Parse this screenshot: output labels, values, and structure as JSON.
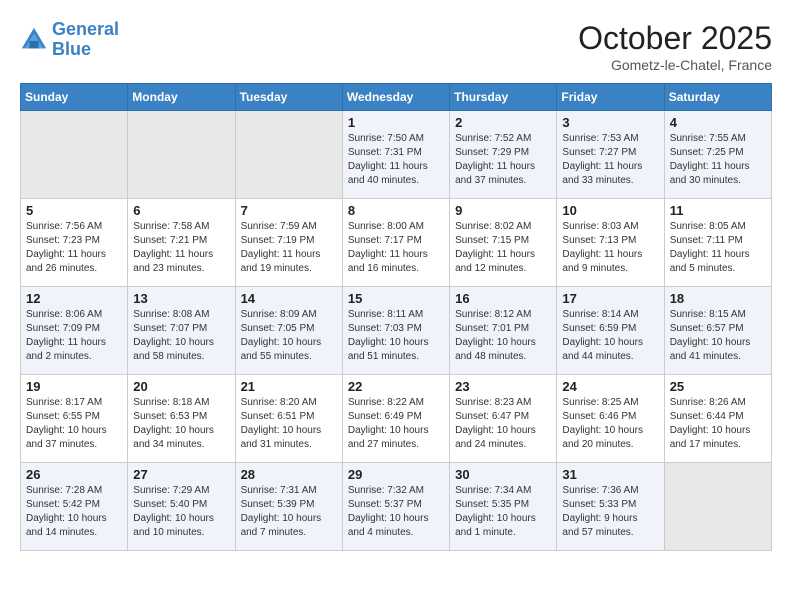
{
  "header": {
    "logo_line1": "General",
    "logo_line2": "Blue",
    "month": "October 2025",
    "location": "Gometz-le-Chatel, France"
  },
  "weekdays": [
    "Sunday",
    "Monday",
    "Tuesday",
    "Wednesday",
    "Thursday",
    "Friday",
    "Saturday"
  ],
  "weeks": [
    [
      {
        "day": "",
        "info": ""
      },
      {
        "day": "",
        "info": ""
      },
      {
        "day": "",
        "info": ""
      },
      {
        "day": "1",
        "info": "Sunrise: 7:50 AM\nSunset: 7:31 PM\nDaylight: 11 hours\nand 40 minutes."
      },
      {
        "day": "2",
        "info": "Sunrise: 7:52 AM\nSunset: 7:29 PM\nDaylight: 11 hours\nand 37 minutes."
      },
      {
        "day": "3",
        "info": "Sunrise: 7:53 AM\nSunset: 7:27 PM\nDaylight: 11 hours\nand 33 minutes."
      },
      {
        "day": "4",
        "info": "Sunrise: 7:55 AM\nSunset: 7:25 PM\nDaylight: 11 hours\nand 30 minutes."
      }
    ],
    [
      {
        "day": "5",
        "info": "Sunrise: 7:56 AM\nSunset: 7:23 PM\nDaylight: 11 hours\nand 26 minutes."
      },
      {
        "day": "6",
        "info": "Sunrise: 7:58 AM\nSunset: 7:21 PM\nDaylight: 11 hours\nand 23 minutes."
      },
      {
        "day": "7",
        "info": "Sunrise: 7:59 AM\nSunset: 7:19 PM\nDaylight: 11 hours\nand 19 minutes."
      },
      {
        "day": "8",
        "info": "Sunrise: 8:00 AM\nSunset: 7:17 PM\nDaylight: 11 hours\nand 16 minutes."
      },
      {
        "day": "9",
        "info": "Sunrise: 8:02 AM\nSunset: 7:15 PM\nDaylight: 11 hours\nand 12 minutes."
      },
      {
        "day": "10",
        "info": "Sunrise: 8:03 AM\nSunset: 7:13 PM\nDaylight: 11 hours\nand 9 minutes."
      },
      {
        "day": "11",
        "info": "Sunrise: 8:05 AM\nSunset: 7:11 PM\nDaylight: 11 hours\nand 5 minutes."
      }
    ],
    [
      {
        "day": "12",
        "info": "Sunrise: 8:06 AM\nSunset: 7:09 PM\nDaylight: 11 hours\nand 2 minutes."
      },
      {
        "day": "13",
        "info": "Sunrise: 8:08 AM\nSunset: 7:07 PM\nDaylight: 10 hours\nand 58 minutes."
      },
      {
        "day": "14",
        "info": "Sunrise: 8:09 AM\nSunset: 7:05 PM\nDaylight: 10 hours\nand 55 minutes."
      },
      {
        "day": "15",
        "info": "Sunrise: 8:11 AM\nSunset: 7:03 PM\nDaylight: 10 hours\nand 51 minutes."
      },
      {
        "day": "16",
        "info": "Sunrise: 8:12 AM\nSunset: 7:01 PM\nDaylight: 10 hours\nand 48 minutes."
      },
      {
        "day": "17",
        "info": "Sunrise: 8:14 AM\nSunset: 6:59 PM\nDaylight: 10 hours\nand 44 minutes."
      },
      {
        "day": "18",
        "info": "Sunrise: 8:15 AM\nSunset: 6:57 PM\nDaylight: 10 hours\nand 41 minutes."
      }
    ],
    [
      {
        "day": "19",
        "info": "Sunrise: 8:17 AM\nSunset: 6:55 PM\nDaylight: 10 hours\nand 37 minutes."
      },
      {
        "day": "20",
        "info": "Sunrise: 8:18 AM\nSunset: 6:53 PM\nDaylight: 10 hours\nand 34 minutes."
      },
      {
        "day": "21",
        "info": "Sunrise: 8:20 AM\nSunset: 6:51 PM\nDaylight: 10 hours\nand 31 minutes."
      },
      {
        "day": "22",
        "info": "Sunrise: 8:22 AM\nSunset: 6:49 PM\nDaylight: 10 hours\nand 27 minutes."
      },
      {
        "day": "23",
        "info": "Sunrise: 8:23 AM\nSunset: 6:47 PM\nDaylight: 10 hours\nand 24 minutes."
      },
      {
        "day": "24",
        "info": "Sunrise: 8:25 AM\nSunset: 6:46 PM\nDaylight: 10 hours\nand 20 minutes."
      },
      {
        "day": "25",
        "info": "Sunrise: 8:26 AM\nSunset: 6:44 PM\nDaylight: 10 hours\nand 17 minutes."
      }
    ],
    [
      {
        "day": "26",
        "info": "Sunrise: 7:28 AM\nSunset: 5:42 PM\nDaylight: 10 hours\nand 14 minutes."
      },
      {
        "day": "27",
        "info": "Sunrise: 7:29 AM\nSunset: 5:40 PM\nDaylight: 10 hours\nand 10 minutes."
      },
      {
        "day": "28",
        "info": "Sunrise: 7:31 AM\nSunset: 5:39 PM\nDaylight: 10 hours\nand 7 minutes."
      },
      {
        "day": "29",
        "info": "Sunrise: 7:32 AM\nSunset: 5:37 PM\nDaylight: 10 hours\nand 4 minutes."
      },
      {
        "day": "30",
        "info": "Sunrise: 7:34 AM\nSunset: 5:35 PM\nDaylight: 10 hours\nand 1 minute."
      },
      {
        "day": "31",
        "info": "Sunrise: 7:36 AM\nSunset: 5:33 PM\nDaylight: 9 hours\nand 57 minutes."
      },
      {
        "day": "",
        "info": ""
      }
    ]
  ]
}
